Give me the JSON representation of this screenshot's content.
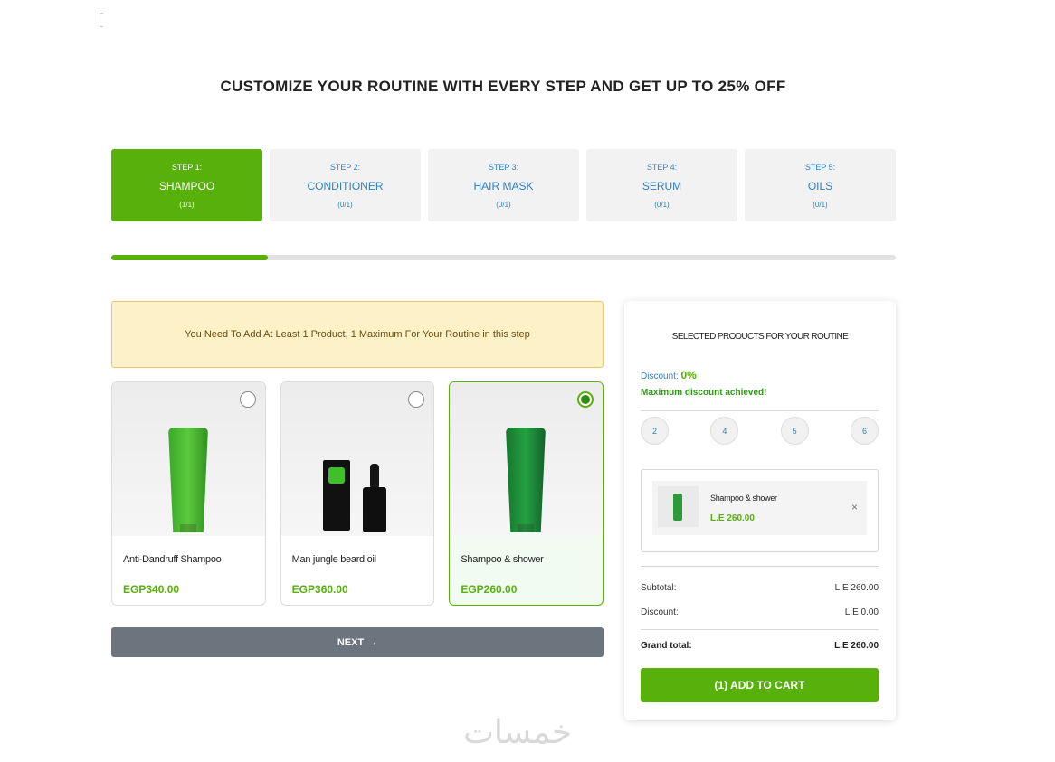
{
  "headline": "CUSTOMIZE YOUR ROUTINE WITH EVERY STEP AND GET UP TO 25% OFF",
  "steps": [
    {
      "num": "STEP 1:",
      "name": "SHAMPOO",
      "count": "(1/1)"
    },
    {
      "num": "STEP 2:",
      "name": "CONDITIONER",
      "count": "(0/1)"
    },
    {
      "num": "STEP 3:",
      "name": "HAIR MASK",
      "count": "(0/1)"
    },
    {
      "num": "STEP 4:",
      "name": "SERUM",
      "count": "(0/1)"
    },
    {
      "num": "STEP 5:",
      "name": "OILS",
      "count": "(0/1)"
    }
  ],
  "progress_fraction": 0.2,
  "notice": "You Need To Add At Least 1 Product, 1 Maximum For Your Routine in this step",
  "products": [
    {
      "name": "Anti-Dandruff Shampoo",
      "price": "EGP340.00"
    },
    {
      "name": "Man jungle beard oil",
      "price": "EGP360.00"
    },
    {
      "name": "Shampoo & shower",
      "price": "EGP260.00"
    }
  ],
  "next_button": {
    "label": "NEXT",
    "arrow": "→"
  },
  "summary": {
    "title": "SELECTED PRODUCTS FOR YOUR ROUTINE",
    "discount_label": "Discount:",
    "discount_value": "0%",
    "max_message": "Maximum discount achieved!",
    "tiers": [
      "2",
      "4",
      "5",
      "6"
    ],
    "selected_item": {
      "name": "Shampoo & shower",
      "price": "L.E 260.00",
      "remove": "×"
    },
    "subtotal_label": "Subtotal:",
    "subtotal_value": "L.E 260.00",
    "discount_row_label": "Discount:",
    "discount_row_value": "L.E 0.00",
    "grand_label": "Grand total:",
    "grand_value": "L.E 260.00",
    "add_to_cart": "(1) ADD TO CART"
  },
  "watermark": "خمسات",
  "colors": {
    "accent": "#57b10a",
    "link": "#2f7fc1",
    "notice_bg": "#fcf1c7",
    "button_gray": "#6c757d"
  }
}
